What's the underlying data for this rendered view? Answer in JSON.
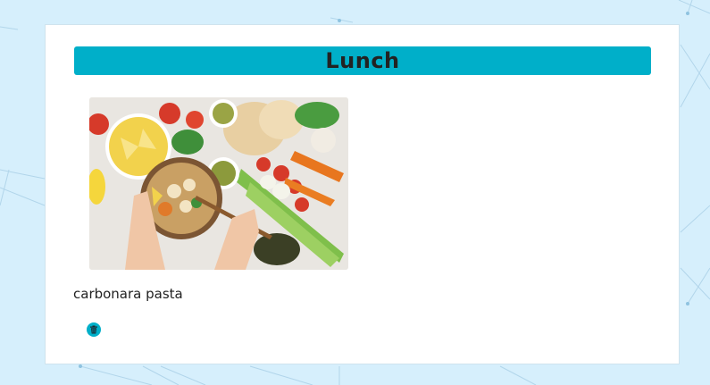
{
  "meal": {
    "title": "Lunch",
    "dish_name": "carbonara pasta",
    "image_alt": "bowl of vegetables with tofu surrounded by fresh produce"
  },
  "icons": {
    "delete": "trash-icon"
  },
  "colors": {
    "background": "#d6effc",
    "accent": "#00afc9",
    "card": "#ffffff",
    "text": "#222222"
  }
}
